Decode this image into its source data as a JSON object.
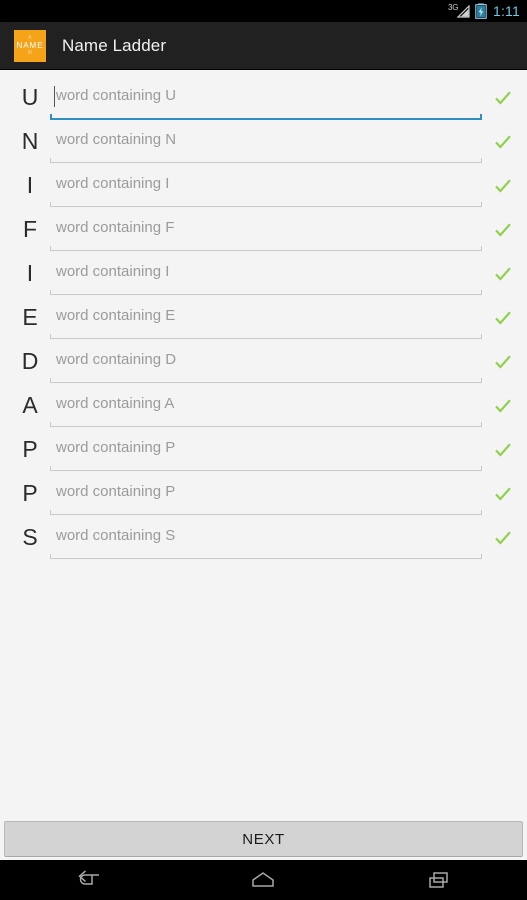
{
  "statusbar": {
    "network_label": "3G",
    "time": "1:11",
    "signal_icon": "signal-triangle-icon",
    "battery_icon": "battery-charging-icon",
    "time_color": "#6ec6e8"
  },
  "actionbar": {
    "app_icon": {
      "name": "app-logo-icon",
      "top_text": "A",
      "mid_text": "NAME",
      "bottom_text": "M",
      "background": "#f5a318"
    },
    "title": "Name Ladder",
    "background": "#212121"
  },
  "ladder": {
    "focused_index": 0,
    "check_icon": "check-icon",
    "check_color": "#8fd14f",
    "focus_color": "#2f8fc0",
    "rows": [
      {
        "letter": "U",
        "placeholder": "word containing U",
        "value": "",
        "checked": true
      },
      {
        "letter": "N",
        "placeholder": "word containing N",
        "value": "",
        "checked": true
      },
      {
        "letter": "I",
        "placeholder": "word containing I",
        "value": "",
        "checked": true
      },
      {
        "letter": "F",
        "placeholder": "word containing F",
        "value": "",
        "checked": true
      },
      {
        "letter": "I",
        "placeholder": "word containing I",
        "value": "",
        "checked": true
      },
      {
        "letter": "E",
        "placeholder": "word containing E",
        "value": "",
        "checked": true
      },
      {
        "letter": "D",
        "placeholder": "word containing D",
        "value": "",
        "checked": true
      },
      {
        "letter": "A",
        "placeholder": "word containing A",
        "value": "",
        "checked": true
      },
      {
        "letter": "P",
        "placeholder": "word containing P",
        "value": "",
        "checked": true
      },
      {
        "letter": "P",
        "placeholder": "word containing P",
        "value": "",
        "checked": true
      },
      {
        "letter": "S",
        "placeholder": "word containing S",
        "value": "",
        "checked": true
      }
    ]
  },
  "footer": {
    "next_label": "NEXT"
  },
  "navbar": {
    "back_icon": "back-arrow-icon",
    "home_icon": "home-icon",
    "recents_icon": "recents-icon"
  }
}
